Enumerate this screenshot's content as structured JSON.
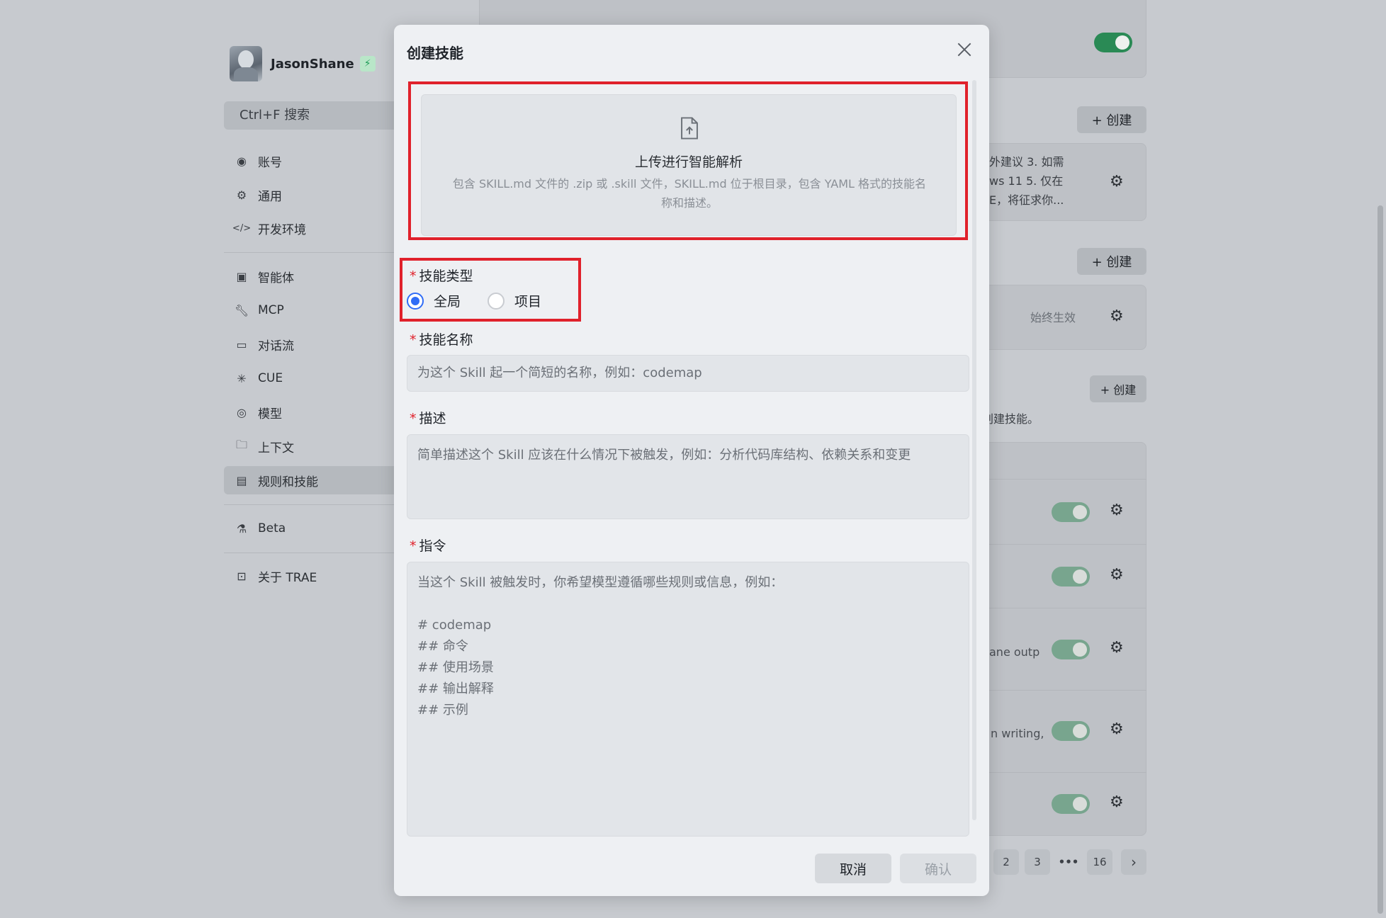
{
  "sidebar": {
    "username": "JasonShane",
    "search_placeholder": "Ctrl+F 搜索",
    "items": [
      {
        "label": "账号",
        "icon": "account-icon"
      },
      {
        "label": "通用",
        "icon": "gear-icon"
      },
      {
        "label": "开发环境",
        "icon": "code-icon"
      },
      {
        "label": "智能体",
        "icon": "agent-icon"
      },
      {
        "label": "MCP",
        "icon": "wrench-icon"
      },
      {
        "label": "对话流",
        "icon": "terminal-icon"
      },
      {
        "label": "CUE",
        "icon": "cue-icon"
      },
      {
        "label": "模型",
        "icon": "model-icon"
      },
      {
        "label": "上下文",
        "icon": "folder-icon"
      },
      {
        "label": "规则和技能",
        "icon": "book-icon"
      },
      {
        "label": "Beta",
        "icon": "flask-icon"
      },
      {
        "label": "关于 TRAE",
        "icon": "trae-icon"
      }
    ]
  },
  "background": {
    "create_label": "+ 创建",
    "card1_text": "外建议 3. 如需\nws 11 5. 仅在\nE，将征求你...",
    "always_active": "始终生效",
    "create_hint": "创建技能。",
    "row3_text": "ane outp",
    "row4_text": "n writing,",
    "pagination": [
      "2",
      "3",
      "•••",
      "16",
      "›"
    ]
  },
  "modal": {
    "title": "创建技能",
    "upload_title": "上传进行智能解析",
    "upload_desc": "包含 SKILL.md 文件的 .zip 或 .skill 文件，SKILL.md 位于根目录，包含 YAML 格式的技能名称和描述。",
    "skill_type_label": "技能类型",
    "radio_global": "全局",
    "radio_project": "项目",
    "name_label": "技能名称",
    "name_placeholder": "为这个 Skill 起一个简短的名称，例如：codemap",
    "desc_label": "描述",
    "desc_placeholder": "简单描述这个 Skill 应该在什么情况下被触发，例如：分析代码库结构、依赖关系和变更",
    "instruction_label": "指令",
    "instruction_placeholder": "当这个 Skill 被触发时，你希望模型遵循哪些规则或信息，例如：\n\n# codemap\n## 命令\n## 使用场景\n## 输出解释\n## 示例",
    "cancel_label": "取消",
    "confirm_label": "确认"
  },
  "colors": {
    "accent": "#2f6cf6",
    "highlight": "#e0212b",
    "toggle_on": "#2a8a55"
  }
}
